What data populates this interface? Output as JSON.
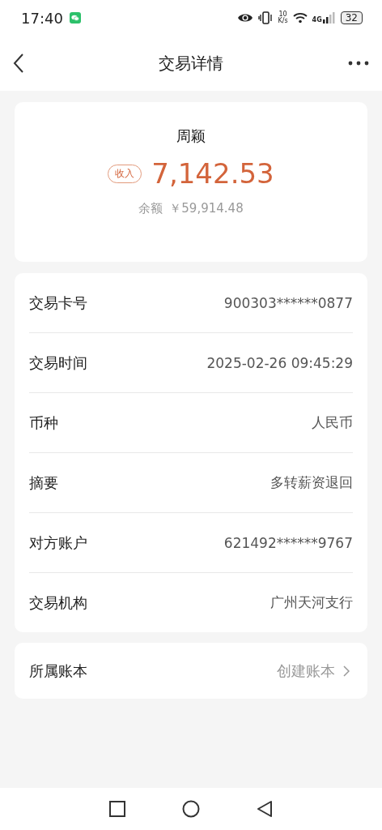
{
  "status_bar": {
    "time": "17:40",
    "speed_value": "10",
    "speed_unit": "K/s",
    "network": "4G",
    "battery": "32"
  },
  "header": {
    "title": "交易详情"
  },
  "summary": {
    "name": "周颖",
    "tag": "收入",
    "amount": "7,142.53",
    "balance_label": "余额",
    "balance": "￥59,914.48"
  },
  "details": [
    {
      "label": "交易卡号",
      "value": "900303******0877"
    },
    {
      "label": "交易时间",
      "value": "2025-02-26 09:45:29"
    },
    {
      "label": "币种",
      "value": "人民币"
    },
    {
      "label": "摘要",
      "value": "多转薪资退回"
    },
    {
      "label": "对方账户",
      "value": "621492******9767"
    },
    {
      "label": "交易机构",
      "value": "广州天河支行"
    }
  ],
  "ledger": {
    "label": "所属账本",
    "action": "创建账本"
  }
}
